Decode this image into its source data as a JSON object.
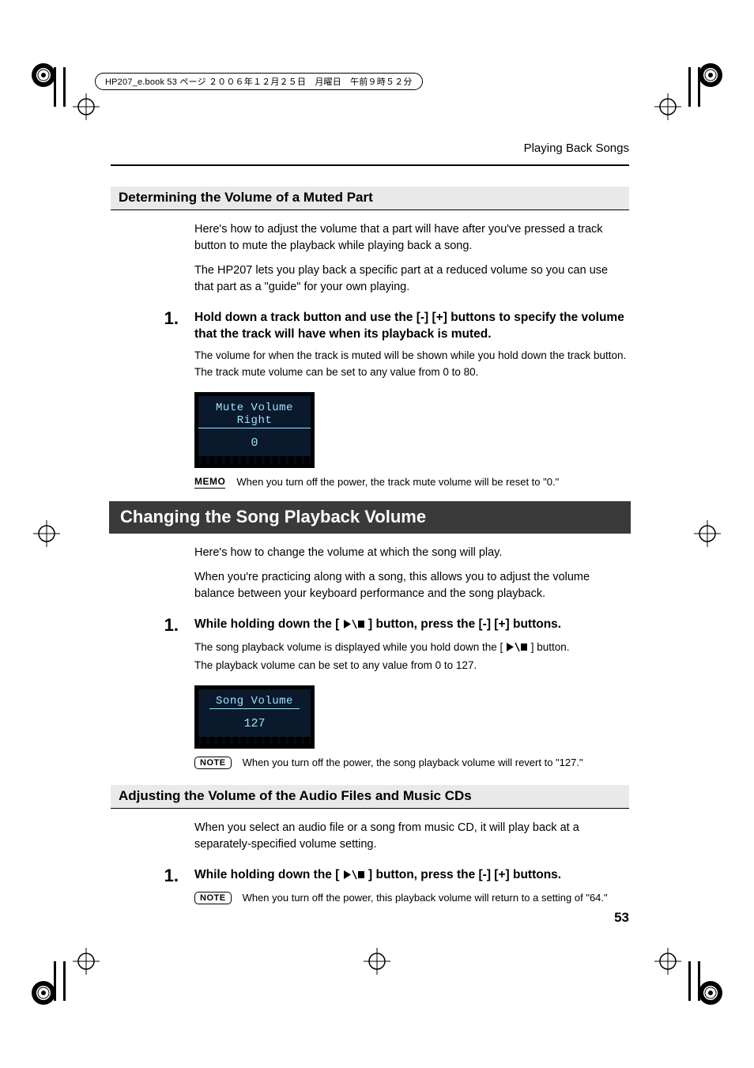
{
  "book_header": "HP207_e.book  53 ページ  ２００６年１２月２５日　月曜日　午前９時５２分",
  "running_head": "Playing Back Songs",
  "page_number": "53",
  "sec1": {
    "heading": "Determining the Volume of a Muted Part",
    "p1": "Here's how to adjust the volume that a part will have after you've pressed a track button to mute the playback while playing back a song.",
    "p2": "The HP207 lets you play back a specific part at a reduced volume so you can use that part as a \"guide\" for your own playing.",
    "step_num": "1.",
    "step_txt": "Hold down a track button and use the [-] [+] buttons to specify the volume that the track will have when its playback is muted.",
    "sp1": "The volume for when the track is muted will be shown while you hold down the track button.",
    "sp2": "The track mute volume can be set to any value from 0 to 80.",
    "lcd_title": "Mute Volume Right",
    "lcd_value": "0",
    "memo": "When you turn off the power, the track mute volume will be reset to \"0.\"",
    "memo_label": "MEMO"
  },
  "sec2": {
    "heading": "Changing the Song Playback Volume",
    "p1": "Here's how to change the volume at which the song will play.",
    "p2": "When you're practicing along with a song, this allows you to adjust the volume balance between your keyboard performance and the song playback.",
    "step_num": "1.",
    "step_pre": "While holding down the [",
    "step_post": "] button, press the [-] [+] buttons.",
    "sp1_pre": "The song playback volume is displayed while you hold down the [",
    "sp1_post": "] button.",
    "sp2": "The playback volume can be set to any value from 0 to 127.",
    "lcd_title": "Song Volume",
    "lcd_value": "127",
    "note": "When you turn off the power, the song playback volume will revert to \"127.\"",
    "note_label": "NOTE"
  },
  "sec3": {
    "heading": "Adjusting the Volume of the Audio Files and Music CDs",
    "p1": "When you select an audio file or a song from music CD, it will play back at a separately-specified volume setting.",
    "step_num": "1.",
    "step_pre": "While holding down the [",
    "step_post": "] button, press the [-] [+] buttons.",
    "note": "When you turn off the power, this playback volume will return to a setting of \"64.\"",
    "note_label": "NOTE"
  }
}
